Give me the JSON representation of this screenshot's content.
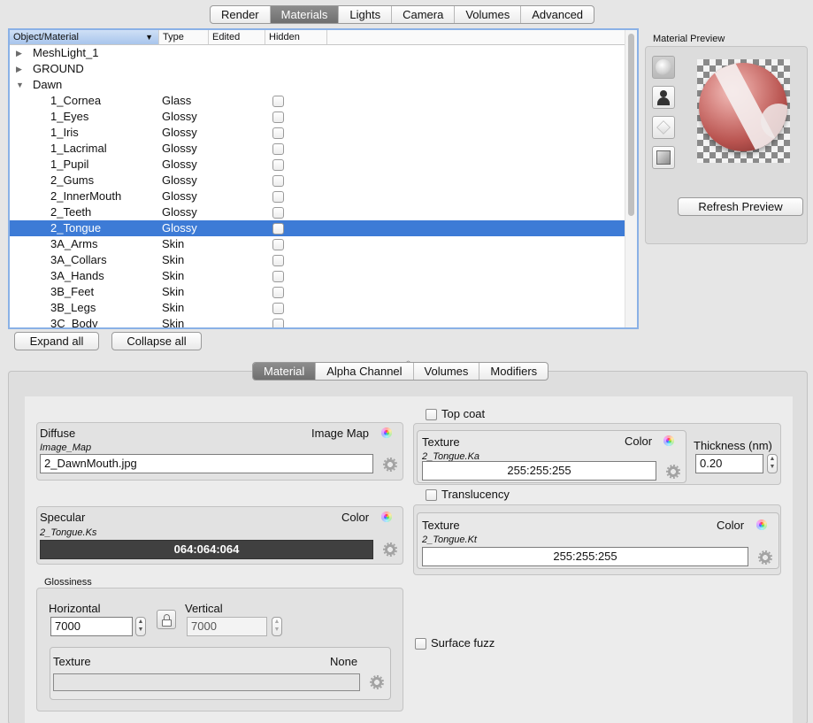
{
  "top_tabs": [
    {
      "label": "Render",
      "active": false
    },
    {
      "label": "Materials",
      "active": true
    },
    {
      "label": "Lights",
      "active": false
    },
    {
      "label": "Camera",
      "active": false
    },
    {
      "label": "Volumes",
      "active": false
    },
    {
      "label": "Advanced",
      "active": false
    }
  ],
  "outline": {
    "columns": {
      "object": "Object/Material",
      "type": "Type",
      "edited": "Edited",
      "hidden": "Hidden"
    },
    "rows": [
      {
        "name": "MeshLight_1",
        "type": "",
        "level": 0,
        "disclosure": "collapsed",
        "checkbox": false,
        "selected": false
      },
      {
        "name": "GROUND",
        "type": "",
        "level": 0,
        "disclosure": "collapsed",
        "checkbox": false,
        "selected": false
      },
      {
        "name": "Dawn",
        "type": "",
        "level": 0,
        "disclosure": "expanded",
        "checkbox": false,
        "selected": false
      },
      {
        "name": "1_Cornea",
        "type": "Glass",
        "level": 1,
        "disclosure": "",
        "checkbox": true,
        "selected": false
      },
      {
        "name": "1_Eyes",
        "type": "Glossy",
        "level": 1,
        "disclosure": "",
        "checkbox": true,
        "selected": false
      },
      {
        "name": "1_Iris",
        "type": "Glossy",
        "level": 1,
        "disclosure": "",
        "checkbox": true,
        "selected": false
      },
      {
        "name": "1_Lacrimal",
        "type": "Glossy",
        "level": 1,
        "disclosure": "",
        "checkbox": true,
        "selected": false
      },
      {
        "name": "1_Pupil",
        "type": "Glossy",
        "level": 1,
        "disclosure": "",
        "checkbox": true,
        "selected": false
      },
      {
        "name": "2_Gums",
        "type": "Glossy",
        "level": 1,
        "disclosure": "",
        "checkbox": true,
        "selected": false
      },
      {
        "name": "2_InnerMouth",
        "type": "Glossy",
        "level": 1,
        "disclosure": "",
        "checkbox": true,
        "selected": false
      },
      {
        "name": "2_Teeth",
        "type": "Glossy",
        "level": 1,
        "disclosure": "",
        "checkbox": true,
        "selected": false
      },
      {
        "name": "2_Tongue",
        "type": "Glossy",
        "level": 1,
        "disclosure": "",
        "checkbox": true,
        "selected": true
      },
      {
        "name": "3A_Arms",
        "type": "Skin",
        "level": 1,
        "disclosure": "",
        "checkbox": true,
        "selected": false
      },
      {
        "name": "3A_Collars",
        "type": "Skin",
        "level": 1,
        "disclosure": "",
        "checkbox": true,
        "selected": false
      },
      {
        "name": "3A_Hands",
        "type": "Skin",
        "level": 1,
        "disclosure": "",
        "checkbox": true,
        "selected": false
      },
      {
        "name": "3B_Feet",
        "type": "Skin",
        "level": 1,
        "disclosure": "",
        "checkbox": true,
        "selected": false
      },
      {
        "name": "3B_Legs",
        "type": "Skin",
        "level": 1,
        "disclosure": "",
        "checkbox": true,
        "selected": false
      },
      {
        "name": "3C_Body",
        "type": "Skin",
        "level": 1,
        "disclosure": "",
        "checkbox": true,
        "selected": false
      }
    ]
  },
  "buttons": {
    "expand_all": "Expand all",
    "collapse_all": "Collapse all",
    "refresh_preview": "Refresh Preview"
  },
  "preview": {
    "title": "Material Preview",
    "shapes": [
      "sphere-icon",
      "figure-icon",
      "cube-icon",
      "plane-icon"
    ],
    "active_shape": "sphere-icon"
  },
  "sub_tabs": [
    {
      "label": "Material",
      "active": true
    },
    {
      "label": "Alpha Channel",
      "active": false
    },
    {
      "label": "Volumes",
      "active": false
    },
    {
      "label": "Modifiers",
      "active": false
    }
  ],
  "diffuse": {
    "label": "Diffuse",
    "mode": "Image Map",
    "node": "Image_Map",
    "value": "2_DawnMouth.jpg"
  },
  "specular": {
    "label": "Specular",
    "mode": "Color",
    "node": "2_Tongue.Ks",
    "value": "064:064:064"
  },
  "glossiness": {
    "label": "Glossiness",
    "horizontal_label": "Horizontal",
    "horizontal": "7000",
    "vertical_label": "Vertical",
    "vertical": "7000",
    "texture_label": "Texture",
    "texture_mode": "None"
  },
  "top_coat": {
    "label": "Top coat",
    "checked": false,
    "texture_label": "Texture",
    "mode": "Color",
    "node": "2_Tongue.Ka",
    "value": "255:255:255",
    "thickness_label": "Thickness (nm)",
    "thickness": "0.20"
  },
  "translucency": {
    "label": "Translucency",
    "checked": false,
    "texture_label": "Texture",
    "mode": "Color",
    "node": "2_Tongue.Kt",
    "value": "255:255:255"
  },
  "surface_fuzz": {
    "label": "Surface fuzz",
    "checked": false
  },
  "colors": {
    "selection": "#3d7bd6",
    "accent": "#8ab1e6",
    "active_tab": "#7a7a7a"
  }
}
